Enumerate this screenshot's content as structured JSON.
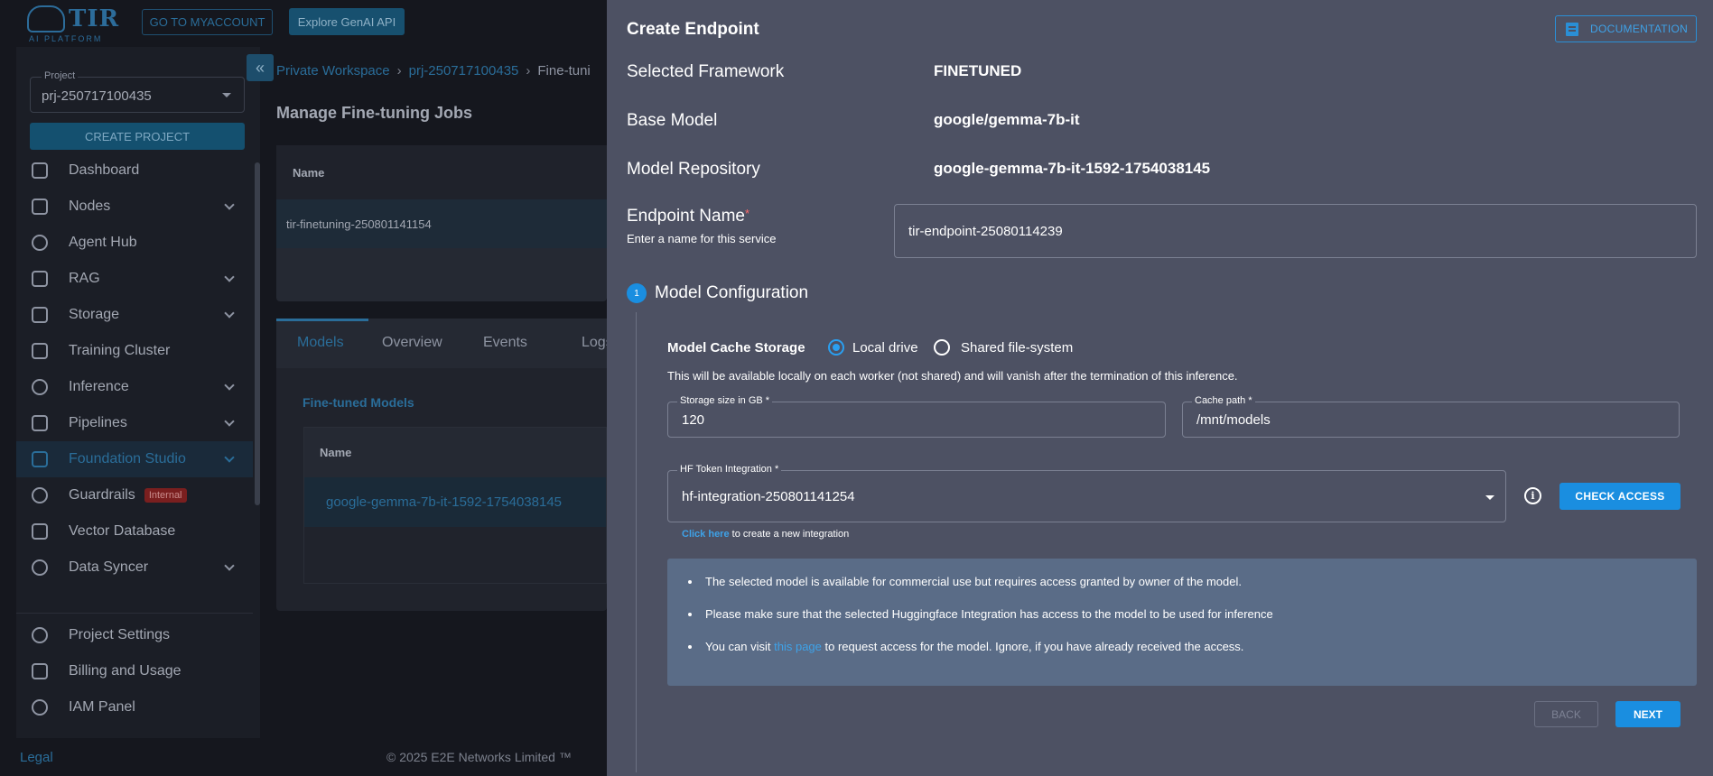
{
  "topbar": {
    "logo_text": "TIR",
    "logo_sub": "AI PLATFORM",
    "my_account": "GO TO MYACCOUNT",
    "genai": "Explore GenAI API"
  },
  "sidebar": {
    "project_label": "Project",
    "project_value": "prj-250717100435",
    "create_project": "CREATE PROJECT",
    "items": [
      {
        "label": "Dashboard",
        "icon": "dashboard-icon",
        "chevron": false
      },
      {
        "label": "Nodes",
        "icon": "nodes-icon",
        "chevron": true
      },
      {
        "label": "Agent Hub",
        "icon": "agent-hub-icon",
        "chevron": false
      },
      {
        "label": "RAG",
        "icon": "rag-icon",
        "chevron": true
      },
      {
        "label": "Storage",
        "icon": "storage-icon",
        "chevron": true
      },
      {
        "label": "Training Cluster",
        "icon": "training-cluster-icon",
        "chevron": false
      },
      {
        "label": "Inference",
        "icon": "inference-icon",
        "chevron": true
      },
      {
        "label": "Pipelines",
        "icon": "pipelines-icon",
        "chevron": true
      },
      {
        "label": "Foundation Studio",
        "icon": "foundation-studio-icon",
        "chevron": true,
        "active": true
      },
      {
        "label": "Guardrails",
        "icon": "guardrails-icon",
        "chevron": false,
        "badge": "Internal"
      },
      {
        "label": "Vector Database",
        "icon": "vector-database-icon",
        "chevron": false
      },
      {
        "label": "Data Syncer",
        "icon": "data-syncer-icon",
        "chevron": true
      }
    ],
    "bottom_items": [
      {
        "label": "Project Settings",
        "icon": "settings-icon"
      },
      {
        "label": "Billing and Usage",
        "icon": "wallet-icon"
      },
      {
        "label": "IAM Panel",
        "icon": "iam-icon"
      }
    ]
  },
  "main": {
    "breadcrumb": [
      "Private Workspace",
      "prj-250717100435",
      "Fine-tuni"
    ],
    "title": "Manage Fine-tuning Jobs",
    "jobs_header": "Name",
    "job_row": "tir-finetuning-250801141154",
    "tabs": [
      "Models",
      "Overview",
      "Events",
      "Logs"
    ],
    "fine_tuned_title": "Fine-tuned Models",
    "models_header": "Name",
    "model_row": "google-gemma-7b-it-1592-1754038145"
  },
  "footer": {
    "legal": "Legal",
    "copyright": "© 2025 E2E Networks Limited ™"
  },
  "drawer": {
    "title": "Create Endpoint",
    "documentation": "DOCUMENTATION",
    "selected_framework_label": "Selected Framework",
    "selected_framework_value": "FINETUNED",
    "base_model_label": "Base Model",
    "base_model_value": "google/gemma-7b-it",
    "model_repo_label": "Model Repository",
    "model_repo_value": "google-gemma-7b-it-1592-1754038145",
    "endpoint_name_label": "Endpoint Name",
    "endpoint_name_required": "*",
    "endpoint_name_hint": "Enter a name for this service",
    "endpoint_name_value": "tir-endpoint-25080114239",
    "step_number": "1",
    "step_title": "Model Configuration",
    "cache_storage_label": "Model Cache Storage",
    "radio_local": "Local drive",
    "radio_shared": "Shared file-system",
    "cache_note": "This will be available locally on each worker (not shared) and will vanish after the termination of this inference.",
    "storage_size_label": "Storage size in GB *",
    "storage_size_value": "120",
    "cache_path_label": "Cache path *",
    "cache_path_value": "/mnt/models",
    "hf_label": "HF Token Integration *",
    "hf_value": "hf-integration-250801141254",
    "check_access": "CHECK ACCESS",
    "click_here": "Click here",
    "click_here_rest": " to create a new integration",
    "notice": {
      "line1": "The selected model is available for commercial use but requires access granted by owner of the model.",
      "line2": "Please make sure that the selected Huggingface Integration has access to the model to be used for inference",
      "line3_pre": "You can visit ",
      "line3_link": "this page",
      "line3_post": " to request access for the model. Ignore, if you have already received the access."
    },
    "back": "BACK",
    "next": "NEXT"
  }
}
